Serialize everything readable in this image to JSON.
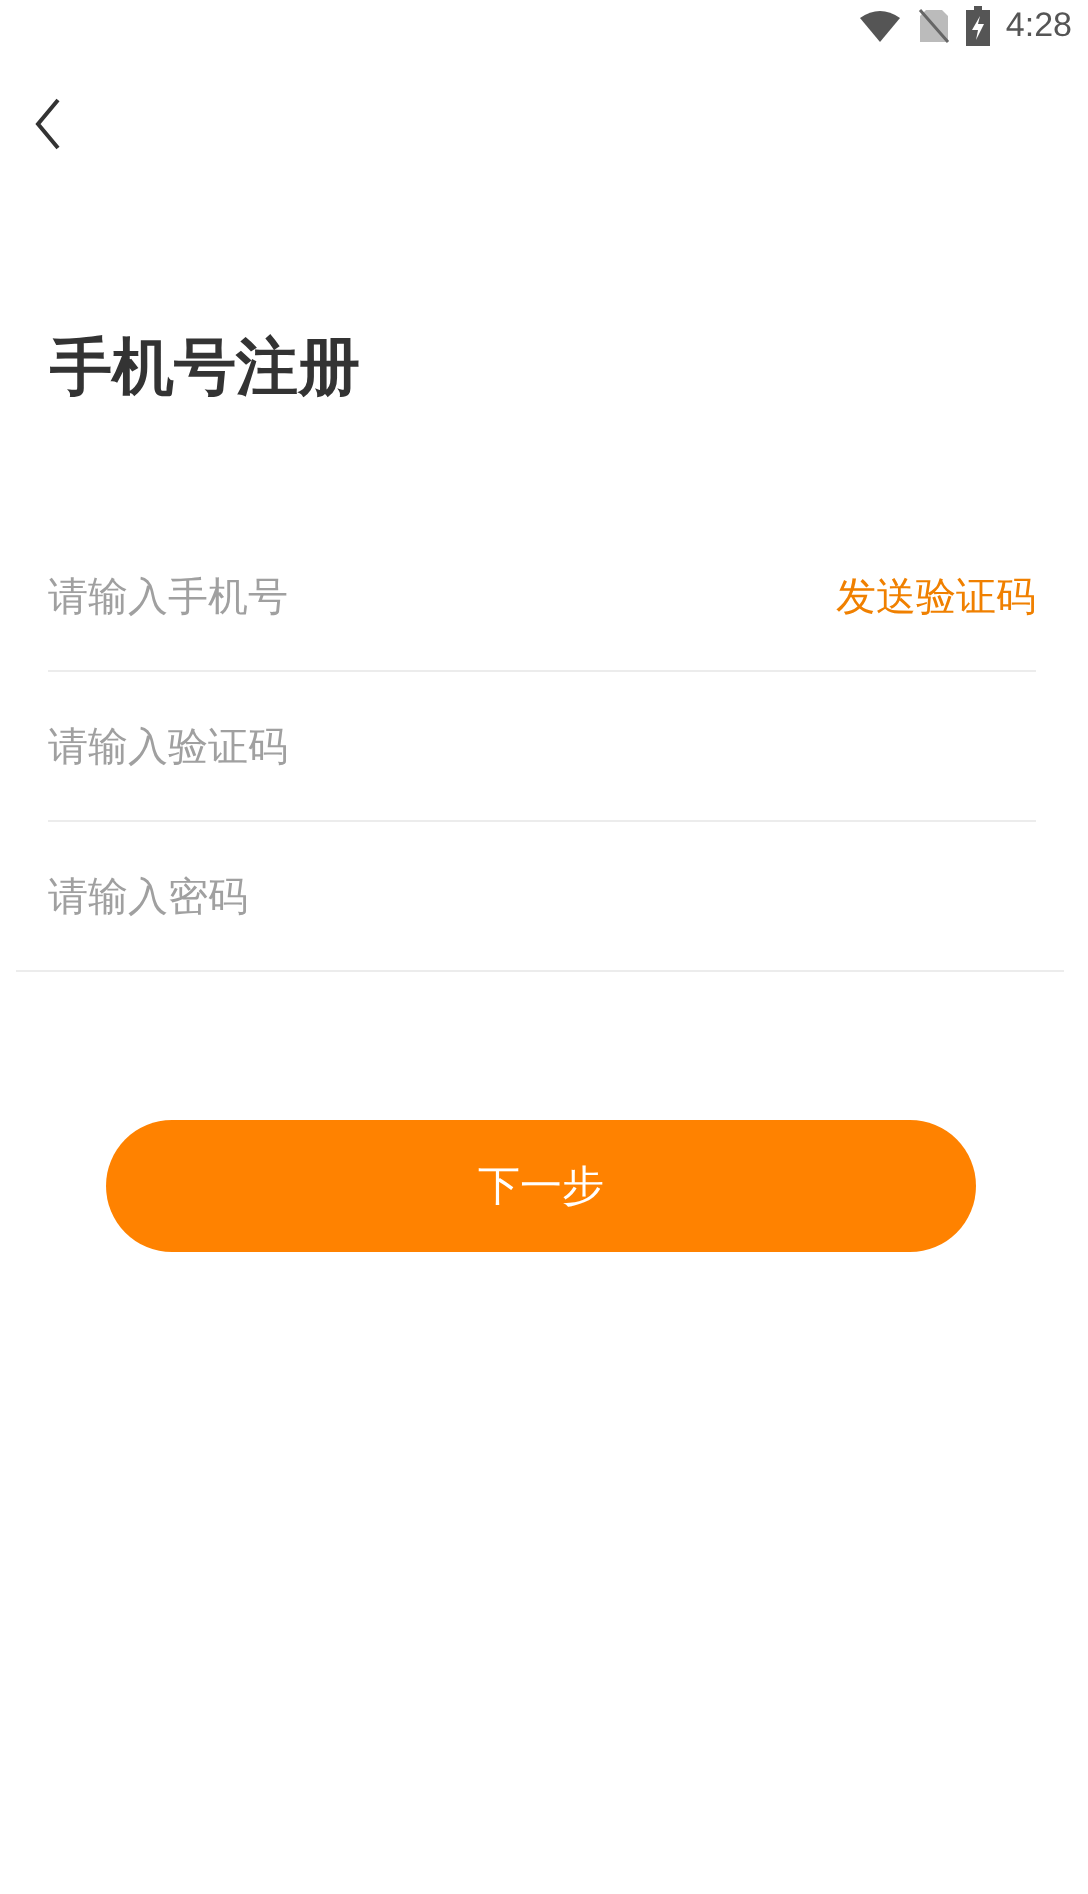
{
  "status_bar": {
    "time": "4:28"
  },
  "title": "手机号注册",
  "fields": [
    {
      "placeholder": "请输入手机号",
      "action": "发送验证码"
    },
    {
      "placeholder": "请输入验证码"
    },
    {
      "placeholder": "请输入密码"
    }
  ],
  "submit_button": "下一步"
}
